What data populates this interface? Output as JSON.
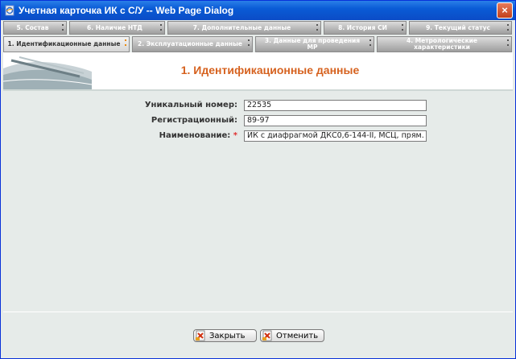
{
  "window": {
    "title": "Учетная карточка ИК с С/У -- Web Page Dialog",
    "close_glyph": "×"
  },
  "tabs_row1": [
    {
      "label": "5. Состав"
    },
    {
      "label": "6. Наличие НТД"
    },
    {
      "label": "7. Дополнительные данные"
    },
    {
      "label": "8. История СИ"
    },
    {
      "label": "9. Текущий статус"
    }
  ],
  "tabs_row2": [
    {
      "label": "1. Идентификационные данные",
      "active": true
    },
    {
      "label": "2. Эксплуатационные данные"
    },
    {
      "label": "3. Данные для проведения МР"
    },
    {
      "label": "4. Метрологические характеристики"
    }
  ],
  "banner": {
    "title": "1. Идентификационные данные"
  },
  "form": {
    "unique_number_label": "Уникальный номер:",
    "unique_number_value": "22535",
    "registration_label": "Регистрационный:",
    "registration_value": "89-97",
    "name_label": "Наименование:",
    "name_required": "*",
    "name_value": "ИК с диафрагмой ДКС0,6-144-II, МСЦ, прям."
  },
  "buttons": {
    "close_label": "Закрыть",
    "cancel_label": "Отменить"
  },
  "colors": {
    "title_accent": "#d6621f",
    "required": "#e03030",
    "titlebar": "#0a5bd6"
  }
}
